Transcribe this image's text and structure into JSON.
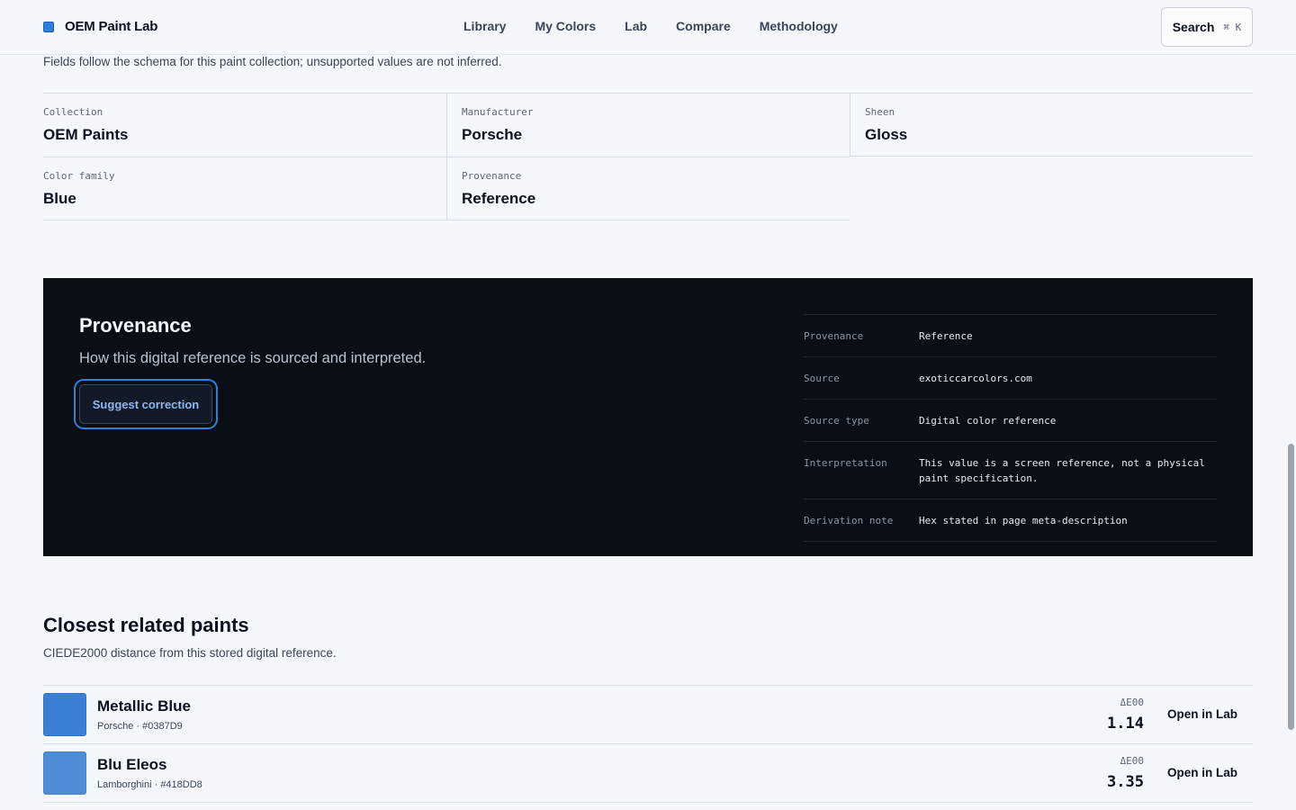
{
  "header": {
    "brand": "OEM Paint Lab",
    "nav": [
      "Library",
      "My Colors",
      "Lab",
      "Compare",
      "Methodology"
    ],
    "search_label": "Search",
    "search_shortcut": "⌘ K"
  },
  "intro": "Fields follow the schema for this paint collection; unsupported values are not inferred.",
  "fields": [
    {
      "key": "Collection",
      "value": "OEM Paints"
    },
    {
      "key": "Manufacturer",
      "value": "Porsche"
    },
    {
      "key": "Sheen",
      "value": "Gloss"
    },
    {
      "key": "Color family",
      "value": "Blue"
    },
    {
      "key": "Provenance",
      "value": "Reference"
    }
  ],
  "provenance": {
    "title": "Provenance",
    "subtitle": "How this digital reference is sourced and interpreted.",
    "button": "Suggest correction",
    "rows": [
      {
        "key": "Provenance",
        "value": "Reference"
      },
      {
        "key": "Source",
        "value": "exoticcarcolors.com"
      },
      {
        "key": "Source type",
        "value": "Digital color reference"
      },
      {
        "key": "Interpretation",
        "value": "This value is a screen reference, not a physical paint specification."
      },
      {
        "key": "Derivation note",
        "value": "Hex stated in page meta-description"
      }
    ]
  },
  "related": {
    "title": "Closest related paints",
    "subtitle": "CIEDE2000 distance from this stored digital reference.",
    "items": [
      {
        "name": "Metallic Blue",
        "meta": "Porsche · #0387D9",
        "swatch": "#3a7fd6",
        "delta_label": "ΔE00",
        "delta": "1.14",
        "action": "Open in Lab"
      },
      {
        "name": "Blu Eleos",
        "meta": "Lamborghini · #418DD8",
        "swatch": "#4f8cd8",
        "delta_label": "ΔE00",
        "delta": "3.35",
        "action": "Open in Lab"
      }
    ]
  },
  "colors": {
    "accent": "#2f7fdc",
    "panel_bg": "#0a0e15",
    "page_bg": "#f4f7fb"
  }
}
